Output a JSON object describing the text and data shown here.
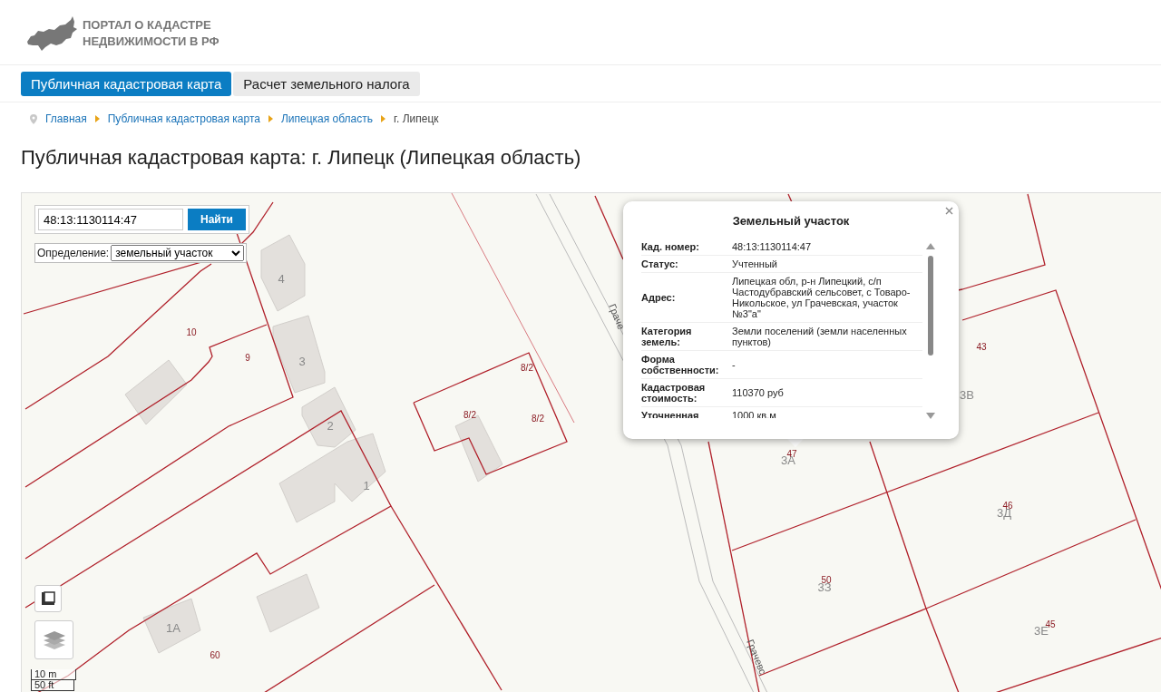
{
  "header": {
    "logo_lines": [
      "ПОРТАЛ О КАДАСТРЕ",
      "НЕДВИЖИМОСТИ В РФ"
    ]
  },
  "tabs": [
    {
      "label": "Публичная кадастровая карта",
      "selected": true
    },
    {
      "label": "Расчет земельного налога",
      "selected": false
    }
  ],
  "breadcrumbs": [
    {
      "label": "Главная",
      "kind": "link"
    },
    {
      "label": "Публичная кадастровая карта",
      "kind": "link"
    },
    {
      "label": "Липецкая область",
      "kind": "link"
    },
    {
      "label": "г. Липецк",
      "kind": "current"
    }
  ],
  "title": "Публичная кадастровая карта: г. Липецк (Липецкая область)",
  "map": {
    "search": {
      "value": "48:13:1130114:47",
      "button": "Найти"
    },
    "definition": {
      "label": "Определение:",
      "value": "земельный участок"
    },
    "labels": [
      {
        "text": "10",
        "kind": "parcel"
      },
      {
        "text": "9",
        "kind": "parcel"
      },
      {
        "text": "8/2",
        "kind": "parcel"
      },
      {
        "text": "8/2",
        "kind": "parcel"
      },
      {
        "text": "8/2",
        "kind": "parcel"
      },
      {
        "text": "60",
        "kind": "parcel"
      },
      {
        "text": "43",
        "kind": "parcel"
      },
      {
        "text": "47",
        "kind": "parcel"
      },
      {
        "text": "46",
        "kind": "parcel"
      },
      {
        "text": "50",
        "kind": "parcel"
      },
      {
        "text": "45",
        "kind": "parcel"
      },
      {
        "text": "4",
        "kind": "house"
      },
      {
        "text": "3",
        "kind": "house"
      },
      {
        "text": "2",
        "kind": "house"
      },
      {
        "text": "1",
        "kind": "house"
      },
      {
        "text": "1А",
        "kind": "house"
      },
      {
        "text": "3В",
        "kind": "house"
      },
      {
        "text": "3А",
        "kind": "house"
      },
      {
        "text": "3Д",
        "kind": "house"
      },
      {
        "text": "3З",
        "kind": "house"
      },
      {
        "text": "3Е",
        "kind": "house"
      },
      {
        "text": "Граче",
        "kind": "street"
      },
      {
        "text": "Грачевс",
        "kind": "street"
      }
    ],
    "scale": [
      "10 m",
      "50 ft"
    ],
    "popup": {
      "title": "Земельный участок",
      "rows": [
        {
          "label": "Кад. номер:",
          "value": "48:13:1130114:47"
        },
        {
          "label": "Статус:",
          "value": "Учтенный"
        },
        {
          "label": "Адрес:",
          "value": "Липецкая обл, р-н Липецкий, с/п Частодубравский сельсовет, с Товаро-Никольское, ул Грачевская, участок №3\"а\""
        },
        {
          "label": "Категория земель:",
          "value": "Земли поселений (земли населенных пунктов)"
        },
        {
          "label": "Форма собственности:",
          "value": "-"
        },
        {
          "label": "Кадастровая стоимость:",
          "value": "110370 руб"
        },
        {
          "label": "Уточненная",
          "value": "1000 кв.м"
        }
      ]
    }
  }
}
